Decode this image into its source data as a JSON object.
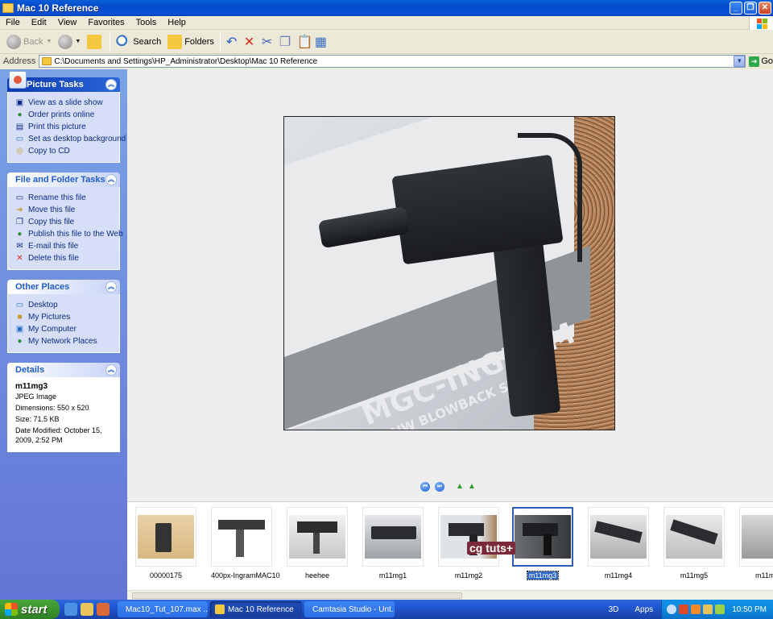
{
  "window": {
    "title": "Mac 10 Reference"
  },
  "menu": [
    "File",
    "Edit",
    "View",
    "Favorites",
    "Tools",
    "Help"
  ],
  "toolbar": {
    "back": "Back",
    "search": "Search",
    "folders": "Folders"
  },
  "address": {
    "label": "Address",
    "path": "C:\\Documents and Settings\\HP_Administrator\\Desktop\\Mac 10 Reference",
    "go": "Go"
  },
  "panels": {
    "picture_tasks": {
      "title": "Picture Tasks",
      "items": [
        "View as a slide show",
        "Order prints online",
        "Print this picture",
        "Set as desktop background",
        "Copy to CD"
      ]
    },
    "file_tasks": {
      "title": "File and Folder Tasks",
      "items": [
        "Rename this file",
        "Move this file",
        "Copy this file",
        "Publish this file to the Web",
        "E-mail this file",
        "Delete this file"
      ]
    },
    "other_places": {
      "title": "Other Places",
      "items": [
        "Desktop",
        "My Pictures",
        "My Computer",
        "My Network Places"
      ]
    },
    "details": {
      "title": "Details",
      "name": "m11mg3",
      "type": "JPEG Image",
      "dimensions": "Dimensions: 550 x 520",
      "size": "Size: 71.5 KB",
      "modified": "Date Modified: October 15, 2009, 2:52 PM"
    }
  },
  "photo": {
    "brand": "MGC-INGRAM",
    "subtitle": "CP-HW BLOWBACK SYST"
  },
  "filmstrip": [
    "00000175",
    "400px-IngramMAC10",
    "heehee",
    "m11mg1",
    "m11mg2",
    "m11mg3",
    "m11mg4",
    "m11mg5",
    "m11m"
  ],
  "overlay": "cg tuts+",
  "taskbar": {
    "start": "start",
    "tasks": [
      "Mac10_Tut_107.max ...",
      "Mac 10 Reference",
      "Camtasia Studio - Unt..."
    ],
    "tray_3d": "3D",
    "tray_apps": "Apps",
    "clock": "10:50 PM"
  },
  "colors": {
    "accent": "#316ac5",
    "title": "#0a52d6",
    "taskpane": "#6e8fe0"
  }
}
